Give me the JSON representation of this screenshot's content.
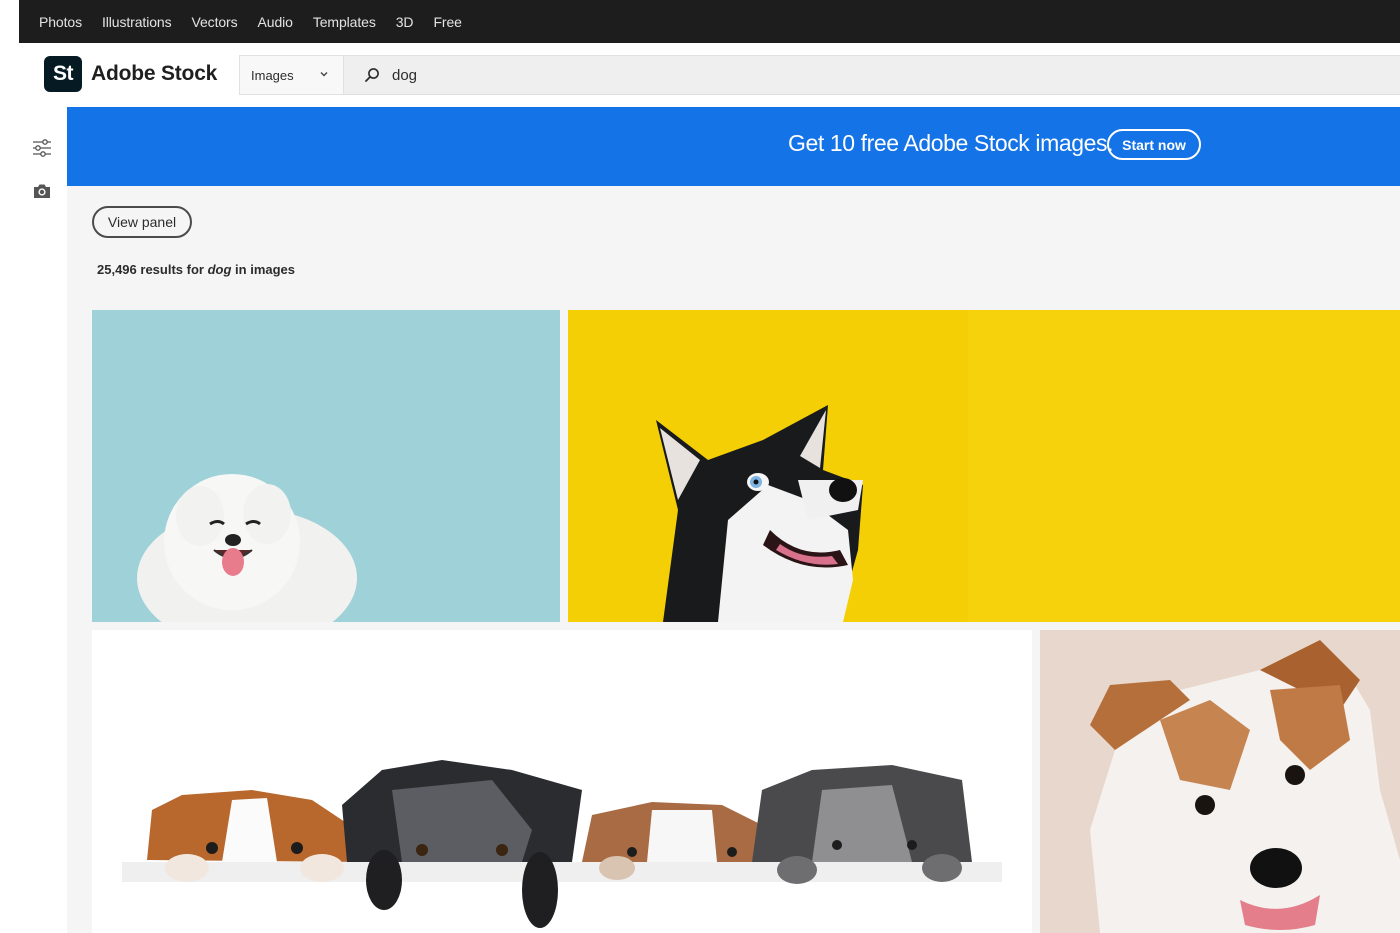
{
  "topnav": {
    "items": [
      "Photos",
      "Illustrations",
      "Vectors",
      "Audio",
      "Templates",
      "3D",
      "Free"
    ]
  },
  "header": {
    "logo_mark": "St",
    "logo_text": "Adobe Stock",
    "search_type": "Images",
    "search_query": "dog"
  },
  "sidebar": {
    "icons": [
      "filter-sliders-icon",
      "camera-icon"
    ]
  },
  "banner": {
    "text": "Get 10 free Adobe Stock images.",
    "cta": "Start now",
    "color": "#1473e6"
  },
  "controls": {
    "view_panel": "View panel"
  },
  "results": {
    "count": "25,496",
    "prefix": "results for",
    "query": "dog",
    "suffix": "in images"
  },
  "gallery": {
    "tiles": [
      {
        "subject": "white-fluffy-dog-on-teal",
        "bg": "#9fd1d8"
      },
      {
        "subject": "husky-on-yellow",
        "bg": "#f4cf05"
      },
      {
        "subject": "dogs-peeking-over-banner",
        "bg": "#ffffff"
      },
      {
        "subject": "jack-russell-puppy",
        "bg": "#e8d7cc"
      }
    ]
  }
}
